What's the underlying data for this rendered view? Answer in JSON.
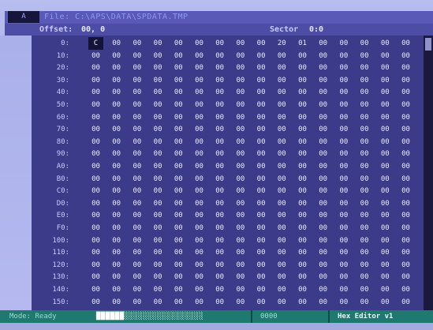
{
  "titlebar": {
    "app_badge": "A",
    "file_label": "File: C:\\APS\\DATA\\SPDATA.TMP"
  },
  "infobar": {
    "offset_label": "Offset:",
    "offset_value": "00, 0",
    "sector_label": "Sector",
    "sector_value": "0:0"
  },
  "hex_grid": {
    "cursor_value": "C",
    "rows": [
      {
        "label": "0:",
        "cells": [
          "C",
          "00",
          "00",
          "00",
          "00",
          "00",
          "00",
          "00",
          "00",
          "20",
          "01",
          "00",
          "00",
          "00",
          "00",
          "00"
        ]
      },
      {
        "label": "10:",
        "cells": [
          "00",
          "00",
          "00",
          "00",
          "00",
          "00",
          "00",
          "00",
          "00",
          "00",
          "00",
          "00",
          "00",
          "00",
          "00",
          "00"
        ]
      },
      {
        "label": "20:",
        "cells": [
          "00",
          "00",
          "00",
          "00",
          "00",
          "00",
          "00",
          "00",
          "00",
          "00",
          "00",
          "00",
          "00",
          "00",
          "00",
          "00"
        ]
      },
      {
        "label": "30:",
        "cells": [
          "00",
          "00",
          "00",
          "00",
          "00",
          "00",
          "00",
          "00",
          "00",
          "00",
          "00",
          "00",
          "00",
          "00",
          "00",
          "00"
        ]
      },
      {
        "label": "40:",
        "cells": [
          "00",
          "00",
          "00",
          "00",
          "00",
          "00",
          "00",
          "00",
          "00",
          "00",
          "00",
          "00",
          "00",
          "00",
          "00",
          "00"
        ]
      },
      {
        "label": "50:",
        "cells": [
          "00",
          "00",
          "00",
          "00",
          "00",
          "00",
          "00",
          "00",
          "00",
          "00",
          "00",
          "00",
          "00",
          "00",
          "00",
          "00"
        ]
      },
      {
        "label": "60:",
        "cells": [
          "00",
          "00",
          "00",
          "00",
          "00",
          "00",
          "00",
          "00",
          "00",
          "00",
          "00",
          "00",
          "00",
          "00",
          "00",
          "00"
        ]
      },
      {
        "label": "70:",
        "cells": [
          "00",
          "00",
          "00",
          "00",
          "00",
          "00",
          "00",
          "00",
          "00",
          "00",
          "00",
          "00",
          "00",
          "00",
          "00",
          "00"
        ]
      },
      {
        "label": "80:",
        "cells": [
          "00",
          "00",
          "00",
          "00",
          "00",
          "00",
          "00",
          "00",
          "00",
          "00",
          "00",
          "00",
          "00",
          "00",
          "00",
          "00"
        ]
      },
      {
        "label": "90:",
        "cells": [
          "00",
          "00",
          "00",
          "00",
          "00",
          "00",
          "00",
          "00",
          "00",
          "00",
          "00",
          "00",
          "00",
          "00",
          "00",
          "00"
        ]
      },
      {
        "label": "A0:",
        "cells": [
          "00",
          "00",
          "00",
          "00",
          "00",
          "00",
          "00",
          "00",
          "00",
          "00",
          "00",
          "00",
          "00",
          "00",
          "00",
          "00"
        ]
      },
      {
        "label": "B0:",
        "cells": [
          "00",
          "00",
          "00",
          "00",
          "00",
          "00",
          "00",
          "00",
          "00",
          "00",
          "00",
          "00",
          "00",
          "00",
          "00",
          "00"
        ]
      },
      {
        "label": "C0:",
        "cells": [
          "00",
          "00",
          "00",
          "00",
          "00",
          "00",
          "00",
          "00",
          "00",
          "00",
          "00",
          "00",
          "00",
          "00",
          "00",
          "00"
        ]
      },
      {
        "label": "D0:",
        "cells": [
          "00",
          "00",
          "00",
          "00",
          "00",
          "00",
          "00",
          "00",
          "00",
          "00",
          "00",
          "00",
          "00",
          "00",
          "00",
          "00"
        ]
      },
      {
        "label": "E0:",
        "cells": [
          "00",
          "00",
          "00",
          "00",
          "00",
          "00",
          "00",
          "00",
          "00",
          "00",
          "00",
          "00",
          "00",
          "00",
          "00",
          "00"
        ]
      },
      {
        "label": "F0:",
        "cells": [
          "00",
          "00",
          "00",
          "00",
          "00",
          "00",
          "00",
          "00",
          "00",
          "00",
          "00",
          "00",
          "00",
          "00",
          "00",
          "00"
        ]
      },
      {
        "label": "100:",
        "cells": [
          "00",
          "00",
          "00",
          "00",
          "00",
          "00",
          "00",
          "00",
          "00",
          "00",
          "00",
          "00",
          "00",
          "00",
          "00",
          "00"
        ]
      },
      {
        "label": "110:",
        "cells": [
          "00",
          "00",
          "00",
          "00",
          "00",
          "00",
          "00",
          "00",
          "00",
          "00",
          "00",
          "00",
          "00",
          "00",
          "00",
          "00"
        ]
      },
      {
        "label": "120:",
        "cells": [
          "00",
          "00",
          "00",
          "00",
          "00",
          "00",
          "00",
          "00",
          "00",
          "00",
          "00",
          "00",
          "00",
          "00",
          "00",
          "00"
        ]
      },
      {
        "label": "130:",
        "cells": [
          "00",
          "00",
          "00",
          "00",
          "00",
          "00",
          "00",
          "00",
          "00",
          "00",
          "00",
          "00",
          "00",
          "00",
          "00",
          "00"
        ]
      },
      {
        "label": "140:",
        "cells": [
          "00",
          "00",
          "00",
          "00",
          "00",
          "00",
          "00",
          "00",
          "00",
          "00",
          "00",
          "00",
          "00",
          "00",
          "00",
          "00"
        ]
      },
      {
        "label": "150:",
        "cells": [
          "00",
          "00",
          "00",
          "00",
          "00",
          "00",
          "00",
          "00",
          "00",
          "00",
          "00",
          "00",
          "00",
          "00",
          "00",
          "00"
        ]
      }
    ]
  },
  "statusbar": {
    "mode_label": "Mode: Ready",
    "progress_text": "██████░░░░░░░░░░░░░░░░░",
    "code_label": "0000",
    "editor_label": "Hex Editor v1"
  },
  "colors": {
    "panel": "#3c3b8a",
    "statusbar": "#1e7a70",
    "text": "#e8e8ff"
  }
}
